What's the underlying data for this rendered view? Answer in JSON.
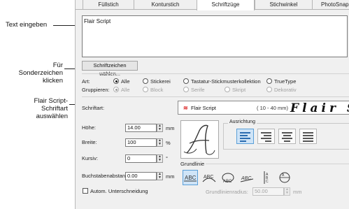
{
  "callouts": {
    "text_input": "Text eingeben",
    "special_chars": [
      "Für",
      "Sonderzeichen",
      "klicken"
    ],
    "font_select": [
      "Flair Script-",
      "Schriftart",
      "auswählen"
    ]
  },
  "tabs": [
    "Füllstich",
    "Konturstich",
    "Schriftzüge",
    "Stichwinkel",
    "PhotoSnap"
  ],
  "active_tab": "Schriftzüge",
  "text_value": "Flair Script",
  "special_chars_button": "Schriftzeichen wählen...",
  "art": {
    "label": "Art:",
    "options": [
      "Alle",
      "Stickerei",
      "Tastatur-Stickmusterkollektion",
      "TrueType"
    ],
    "selected": "Alle"
  },
  "gruppieren": {
    "label": "Gruppieren:",
    "options": [
      "Alle",
      "Block",
      "Serife",
      "Skript",
      "Dekorativ"
    ],
    "selected": "Alle"
  },
  "schriftart": {
    "label": "Schriftart:",
    "name": "Flair Script",
    "range": "( 10 - 40 mm)",
    "preview": "Flair Sc"
  },
  "fields": {
    "hoehe": {
      "label": "Höhe:",
      "value": "14.00",
      "unit": "mm"
    },
    "breite": {
      "label": "Breite:",
      "value": "100",
      "unit": "%"
    },
    "kursiv": {
      "label": "Kursiv:",
      "value": "0",
      "unit": "°"
    },
    "abstand": {
      "label": "Buchstabenabstand:",
      "value": "0.00",
      "unit": "mm"
    }
  },
  "checkbox_label": "Autom. Unterschneidung",
  "ausrichtung_label": "Ausrichtung",
  "grundlinie_label": "Grundlinie",
  "grundlinienradius": {
    "label": "Grundlinienradius:",
    "value": "50.00",
    "unit": "mm"
  },
  "icons": {
    "letter_preview": "script-letter-A-icon",
    "align": [
      "align-left-icon",
      "align-right-icon",
      "align-center-icon",
      "align-justify-icon"
    ],
    "baseline": [
      "baseline-straight-icon",
      "baseline-arc-up-icon",
      "baseline-arc-down-icon",
      "baseline-free-icon",
      "baseline-vertical-icon",
      "baseline-circle-icon"
    ]
  },
  "colors": {
    "selected": "#cfe4f7",
    "selected_border": "#5a9fd8",
    "font_icon": "#dd3333"
  }
}
